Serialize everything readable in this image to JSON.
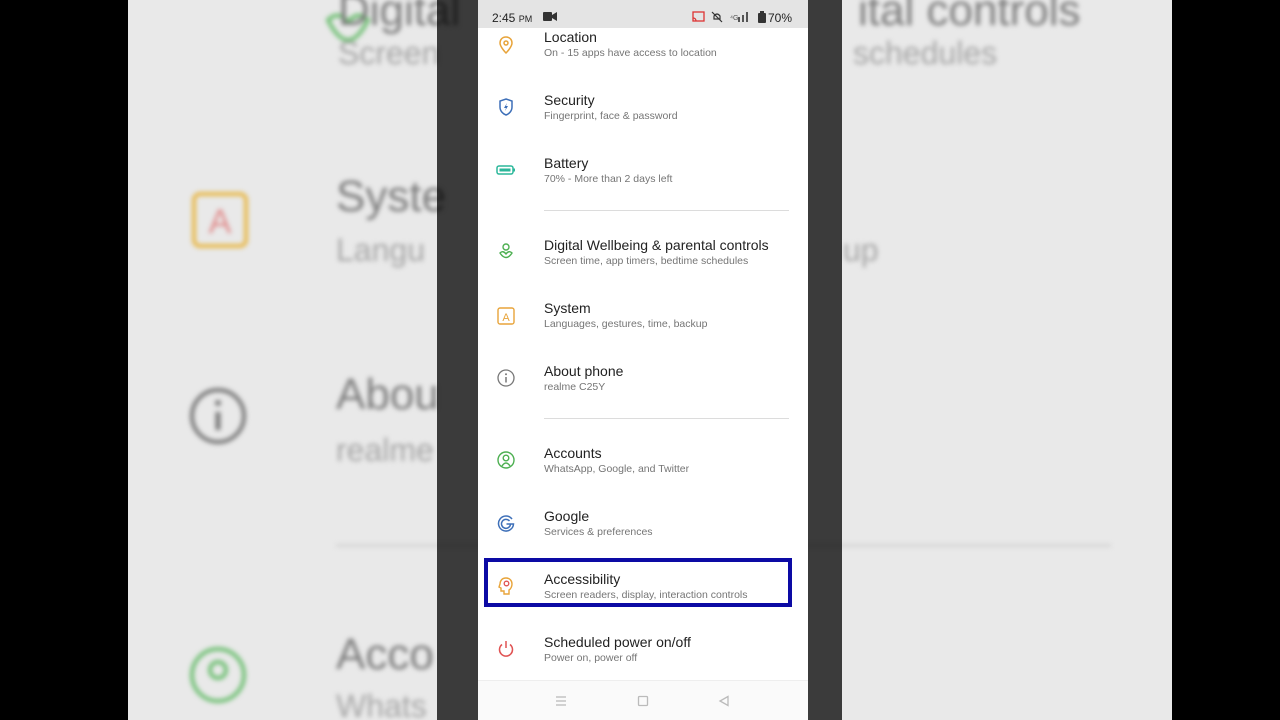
{
  "status_bar": {
    "time": "2:45",
    "ampm": "PM",
    "battery": "70%"
  },
  "settings_items": [
    {
      "title": "Location",
      "subtitle": "On - 15 apps have access to location",
      "icon": "location-icon",
      "color": "#e8a43a"
    },
    {
      "title": "Security",
      "subtitle": "Fingerprint, face & password",
      "icon": "shield-icon",
      "color": "#3d6fb8"
    },
    {
      "title": "Battery",
      "subtitle": "70% - More than 2 days left",
      "icon": "battery-icon",
      "color": "#2bb79a"
    },
    {
      "title": "Digital Wellbeing & parental controls",
      "subtitle": "Screen time, app timers, bedtime schedules",
      "icon": "wellbeing-icon",
      "color": "#4caf50"
    },
    {
      "title": "System",
      "subtitle": "Languages, gestures, time, backup",
      "icon": "system-icon",
      "color": "#e8a43a"
    },
    {
      "title": "About phone",
      "subtitle": "realme C25Y",
      "icon": "info-icon",
      "color": "#777777"
    },
    {
      "title": "Accounts",
      "subtitle": "WhatsApp, Google, and Twitter",
      "icon": "accounts-icon",
      "color": "#4caf50"
    },
    {
      "title": "Google",
      "subtitle": "Services & preferences",
      "icon": "google-icon",
      "color": "#3d6fb8"
    },
    {
      "title": "Accessibility",
      "subtitle": "Screen readers, display, interaction controls",
      "icon": "accessibility-icon",
      "color": "#e8a43a"
    },
    {
      "title": "Scheduled power on/off",
      "subtitle": "Power on, power off",
      "icon": "power-icon",
      "color": "#e05252"
    }
  ],
  "background_zoom": {
    "row1_title": "Digital",
    "row1_title_right": "ital controls",
    "row1_sub": "Screen",
    "row1_sub_right": "schedules",
    "row2_title": "Syste",
    "row2_sub": "Langu",
    "row2_sub_right": "up",
    "row3_title": "Abou",
    "row3_sub": "realme",
    "row4_title": "Acco",
    "row4_sub": "Whats"
  },
  "accent_colors": {
    "highlight_border": "#0c0aa4"
  }
}
